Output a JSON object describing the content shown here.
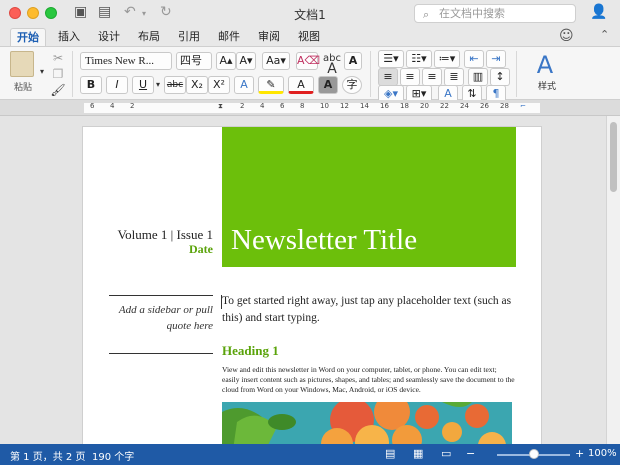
{
  "window": {
    "title": "文档1"
  },
  "search": {
    "placeholder": "在文档中搜索"
  },
  "quick_access": {
    "save": "save-icon",
    "undo": "undo-icon",
    "redo": "redo-icon"
  },
  "tabs": [
    "开始",
    "插入",
    "设计",
    "布局",
    "引用",
    "邮件",
    "审阅",
    "视图"
  ],
  "active_tab": "开始",
  "ribbon": {
    "paste_label": "粘贴",
    "font_name": "Times New R...",
    "font_size": "四号",
    "bold": "B",
    "italic": "I",
    "underline": "U",
    "strikethrough": "abc",
    "subscript": "X₂",
    "superscript": "X²",
    "styles_label": "样式"
  },
  "document": {
    "volume_issue": "Volume 1 | Issue 1",
    "date": "Date",
    "title": "Newsletter Title",
    "sidebar": "Add a sidebar or pull quote here",
    "lead": "To get started right away, just tap any placeholder text (such as this) and start typing.",
    "heading1": "Heading 1",
    "body": "View and edit this newsletter in Word on your computer, tablet, or phone. You can edit text; easily insert content such as pictures, shapes, and tables; and seamlessly save the document to the cloud from Word on your Windows, Mac, Android, or iOS device."
  },
  "status": {
    "page": "第 1 页，共 2 页",
    "words": "190 个字",
    "zoom": "100%",
    "zoom_level": 0.5
  },
  "colors": {
    "accent_green": "#6cbf0b",
    "status_blue": "#1f5aa6",
    "heading_green": "#5aa30a"
  }
}
